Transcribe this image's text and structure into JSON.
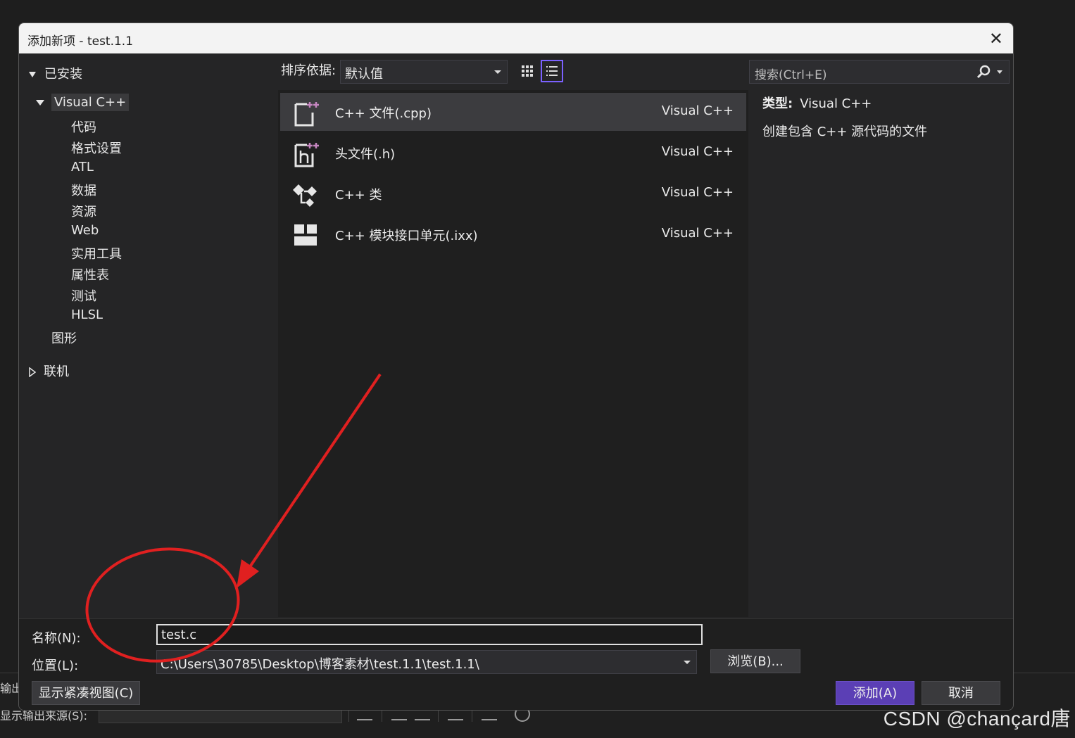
{
  "dialog": {
    "title": "添加新项 - test.1.1",
    "close_glyph": "✕"
  },
  "tree": {
    "installed": "已安装",
    "visual_cpp": "Visual C++",
    "children": [
      "代码",
      "格式设置",
      "ATL",
      "数据",
      "资源",
      "Web",
      "实用工具",
      "属性表",
      "测试",
      "HLSL"
    ],
    "graphics": "图形",
    "online": "联机"
  },
  "toolbar": {
    "sort_label": "排序依据:",
    "sort_value": "默认值",
    "search_placeholder": "搜索(Ctrl+E)"
  },
  "items": [
    {
      "name": "C++ 文件(.cpp)",
      "type": "Visual C++",
      "icon": "cpp-file-icon",
      "selected": true
    },
    {
      "name": "头文件(.h)",
      "type": "Visual C++",
      "icon": "header-file-icon",
      "selected": false
    },
    {
      "name": "C++ 类",
      "type": "Visual C++",
      "icon": "cpp-class-icon",
      "selected": false
    },
    {
      "name": "C++ 模块接口单元(.ixx)",
      "type": "Visual C++",
      "icon": "module-interface-icon",
      "selected": false
    }
  ],
  "details": {
    "type_label": "类型:",
    "type_value": "Visual C++",
    "description": "创建包含 C++ 源代码的文件"
  },
  "bottom": {
    "name_label": "名称(N):",
    "name_value": "test.c",
    "location_label": "位置(L):",
    "location_value": "C:\\Users\\30785\\Desktop\\博客素材\\test.1.1\\test.1.1\\",
    "browse_button": "浏览(B)...",
    "compact_view_button": "显示紧凑视图(C)",
    "add_button": "添加(A)",
    "cancel_button": "取消"
  },
  "background": {
    "output_label": "输出",
    "show_output_from_label": "显示输出来源(S):",
    "watermark": "CSDN @chançard唐"
  },
  "colors": {
    "dialog_bg": "#252526",
    "list_bg": "#1f1f1f",
    "selected_row": "#3c3c3f",
    "primary_button": "#5b3fb5",
    "annotation_red": "#e02020",
    "icon_plus": "#c586c0"
  }
}
